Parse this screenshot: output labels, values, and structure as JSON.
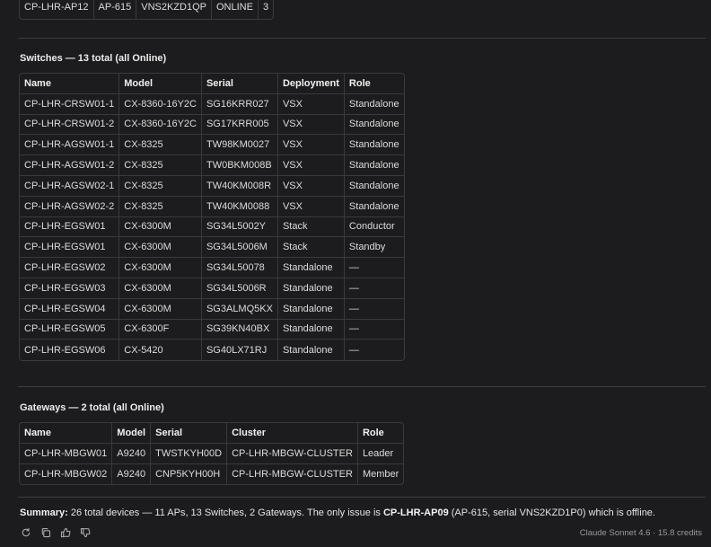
{
  "ap_rows": [
    [
      "CP-LHR-AP12",
      "AP-615",
      "VNS2KZD1QP",
      "ONLINE",
      "3"
    ]
  ],
  "switches": {
    "title": "Switches — 13 total (all Online)",
    "headers": [
      "Name",
      "Model",
      "Serial",
      "Deployment",
      "Role"
    ],
    "rows": [
      [
        "CP-LHR-CRSW01-1",
        "CX-8360-16Y2C",
        "SG16KRR027",
        "VSX",
        "Standalone"
      ],
      [
        "CP-LHR-CRSW01-2",
        "CX-8360-16Y2C",
        "SG17KRR005",
        "VSX",
        "Standalone"
      ],
      [
        "CP-LHR-AGSW01-1",
        "CX-8325",
        "TW98KM0027",
        "VSX",
        "Standalone"
      ],
      [
        "CP-LHR-AGSW01-2",
        "CX-8325",
        "TW0BKM008B",
        "VSX",
        "Standalone"
      ],
      [
        "CP-LHR-AGSW02-1",
        "CX-8325",
        "TW40KM008R",
        "VSX",
        "Standalone"
      ],
      [
        "CP-LHR-AGSW02-2",
        "CX-8325",
        "TW40KM0088",
        "VSX",
        "Standalone"
      ],
      [
        "CP-LHR-EGSW01",
        "CX-6300M",
        "SG34L5002Y",
        "Stack",
        "Conductor"
      ],
      [
        "CP-LHR-EGSW01",
        "CX-6300M",
        "SG34L5006M",
        "Stack",
        "Standby"
      ],
      [
        "CP-LHR-EGSW02",
        "CX-6300M",
        "SG34L50078",
        "Standalone",
        "—"
      ],
      [
        "CP-LHR-EGSW03",
        "CX-6300M",
        "SG34L5006R",
        "Standalone",
        "—"
      ],
      [
        "CP-LHR-EGSW04",
        "CX-6300M",
        "SG3ALMQ5KX",
        "Standalone",
        "—"
      ],
      [
        "CP-LHR-EGSW05",
        "CX-6300F",
        "SG39KN40BX",
        "Standalone",
        "—"
      ],
      [
        "CP-LHR-EGSW06",
        "CX-5420",
        "SG40LX71RJ",
        "Standalone",
        "—"
      ]
    ]
  },
  "gateways": {
    "title": "Gateways — 2 total (all Online)",
    "headers": [
      "Name",
      "Model",
      "Serial",
      "Cluster",
      "Role"
    ],
    "rows": [
      [
        "CP-LHR-MBGW01",
        "A9240",
        "TWSTKYH00D",
        "CP-LHR-MBGW-CLUSTER",
        "Leader"
      ],
      [
        "CP-LHR-MBGW02",
        "A9240",
        "CNP5KYH00H",
        "CP-LHR-MBGW-CLUSTER",
        "Member"
      ]
    ]
  },
  "summary": {
    "label": "Summary:",
    "text1": " 26 total devices — 11 APs, 13 Switches, 2 Gateways. The only issue is ",
    "highlight": "CP-LHR-AP09",
    "text2": " (AP-615, serial VNS2KZD1P0) which is offline."
  },
  "actions": [
    "retry-icon",
    "copy-icon",
    "thumbs-up-icon",
    "thumbs-down-icon"
  ],
  "footer": {
    "model_credit": "Claude Sonnet 4.6 · 15.8 credits"
  }
}
